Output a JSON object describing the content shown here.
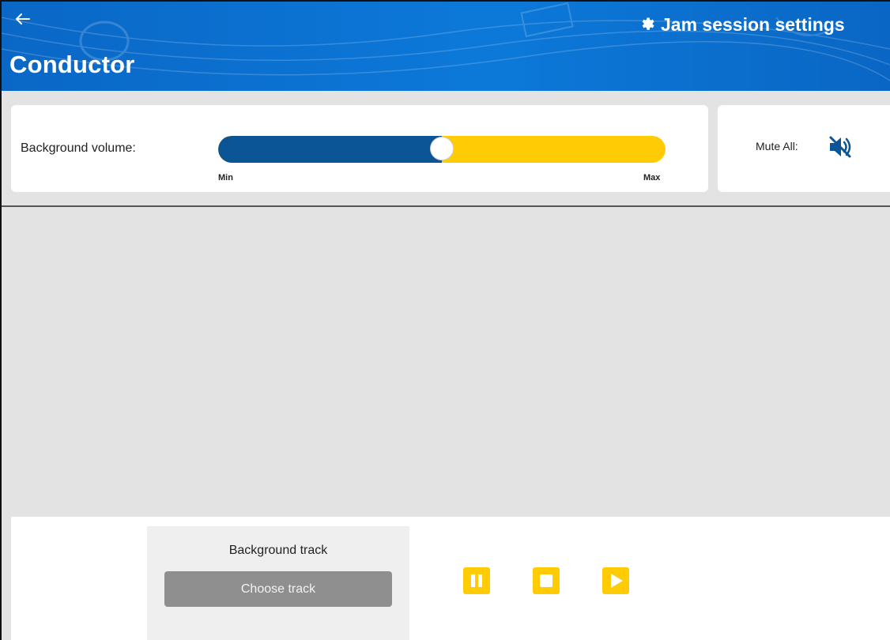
{
  "header": {
    "title": "Conductor",
    "settings_label": "Jam session settings",
    "back_icon": "back-arrow-icon",
    "settings_icon": "gear-icon",
    "color": "#0a6fcf"
  },
  "volume": {
    "label": "Background volume:",
    "min_label": "Min",
    "max_label": "Max",
    "level": 0.5,
    "fill_color": "#0b5496",
    "track_color": "#ffcb05"
  },
  "mute": {
    "label": "Mute All:",
    "icon": "speaker-muted-icon"
  },
  "background_track": {
    "title": "Background track",
    "choose_label": "Choose track"
  },
  "controls": {
    "pause_icon": "pause-icon",
    "stop_icon": "stop-icon",
    "play_icon": "play-icon",
    "color": "#ffcb05"
  }
}
